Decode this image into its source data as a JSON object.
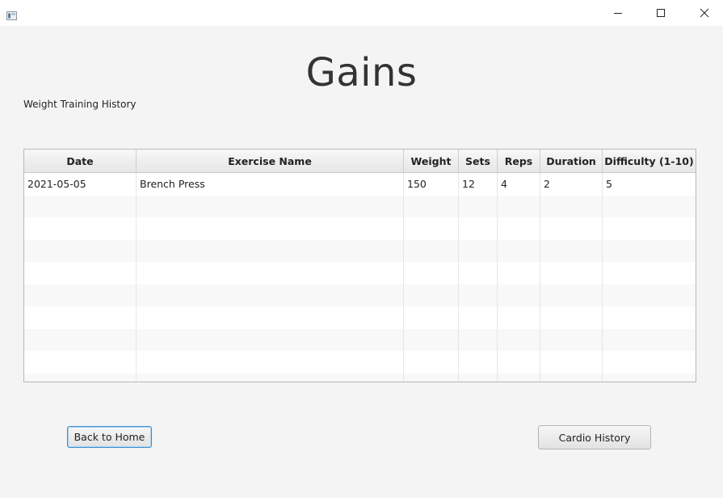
{
  "window": {
    "icons": {
      "app": "app-window-icon",
      "minimize": "minimize-icon",
      "maximize": "maximize-icon",
      "close": "close-icon"
    }
  },
  "page": {
    "title": "Gains",
    "subtitle": "Weight Training History"
  },
  "table": {
    "columns": [
      "Date",
      "Exercise Name",
      "Weight",
      "Sets",
      "Reps",
      "Duration",
      "Difficulty (1-10)"
    ],
    "rows": [
      [
        "2021-05-05",
        "Brench Press",
        "150",
        "12",
        "4",
        "2",
        "5"
      ]
    ]
  },
  "buttons": {
    "back_home": "Back to Home",
    "cardio_history": "Cardio History"
  }
}
